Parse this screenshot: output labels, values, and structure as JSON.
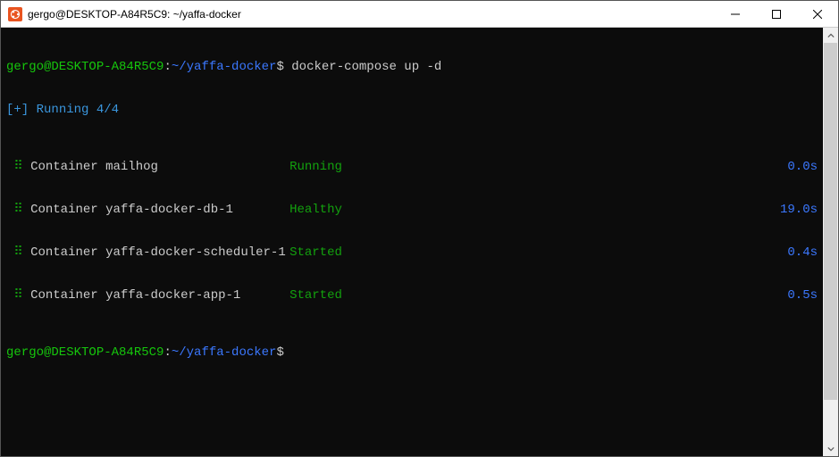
{
  "titlebar": {
    "title": "gergo@DESKTOP-A84R5C9: ~/yaffa-docker"
  },
  "prompt": {
    "userhost": "gergo@DESKTOP-A84R5C9",
    "sep": ":",
    "path": "~/yaffa-docker",
    "sign": "$"
  },
  "command": "docker-compose up -d",
  "running": {
    "prefix": "[+]",
    "label": "Running",
    "count": "4/4"
  },
  "containers": [
    {
      "mark": "⠿",
      "name": "Container mailhog",
      "status": "Running",
      "time": "0.0s"
    },
    {
      "mark": "⠿",
      "name": "Container yaffa-docker-db-1",
      "status": "Healthy",
      "time": "19.0s"
    },
    {
      "mark": "⠿",
      "name": "Container yaffa-docker-scheduler-1",
      "status": "Started",
      "time": "0.4s"
    },
    {
      "mark": "⠿",
      "name": "Container yaffa-docker-app-1",
      "status": "Started",
      "time": "0.5s"
    }
  ]
}
